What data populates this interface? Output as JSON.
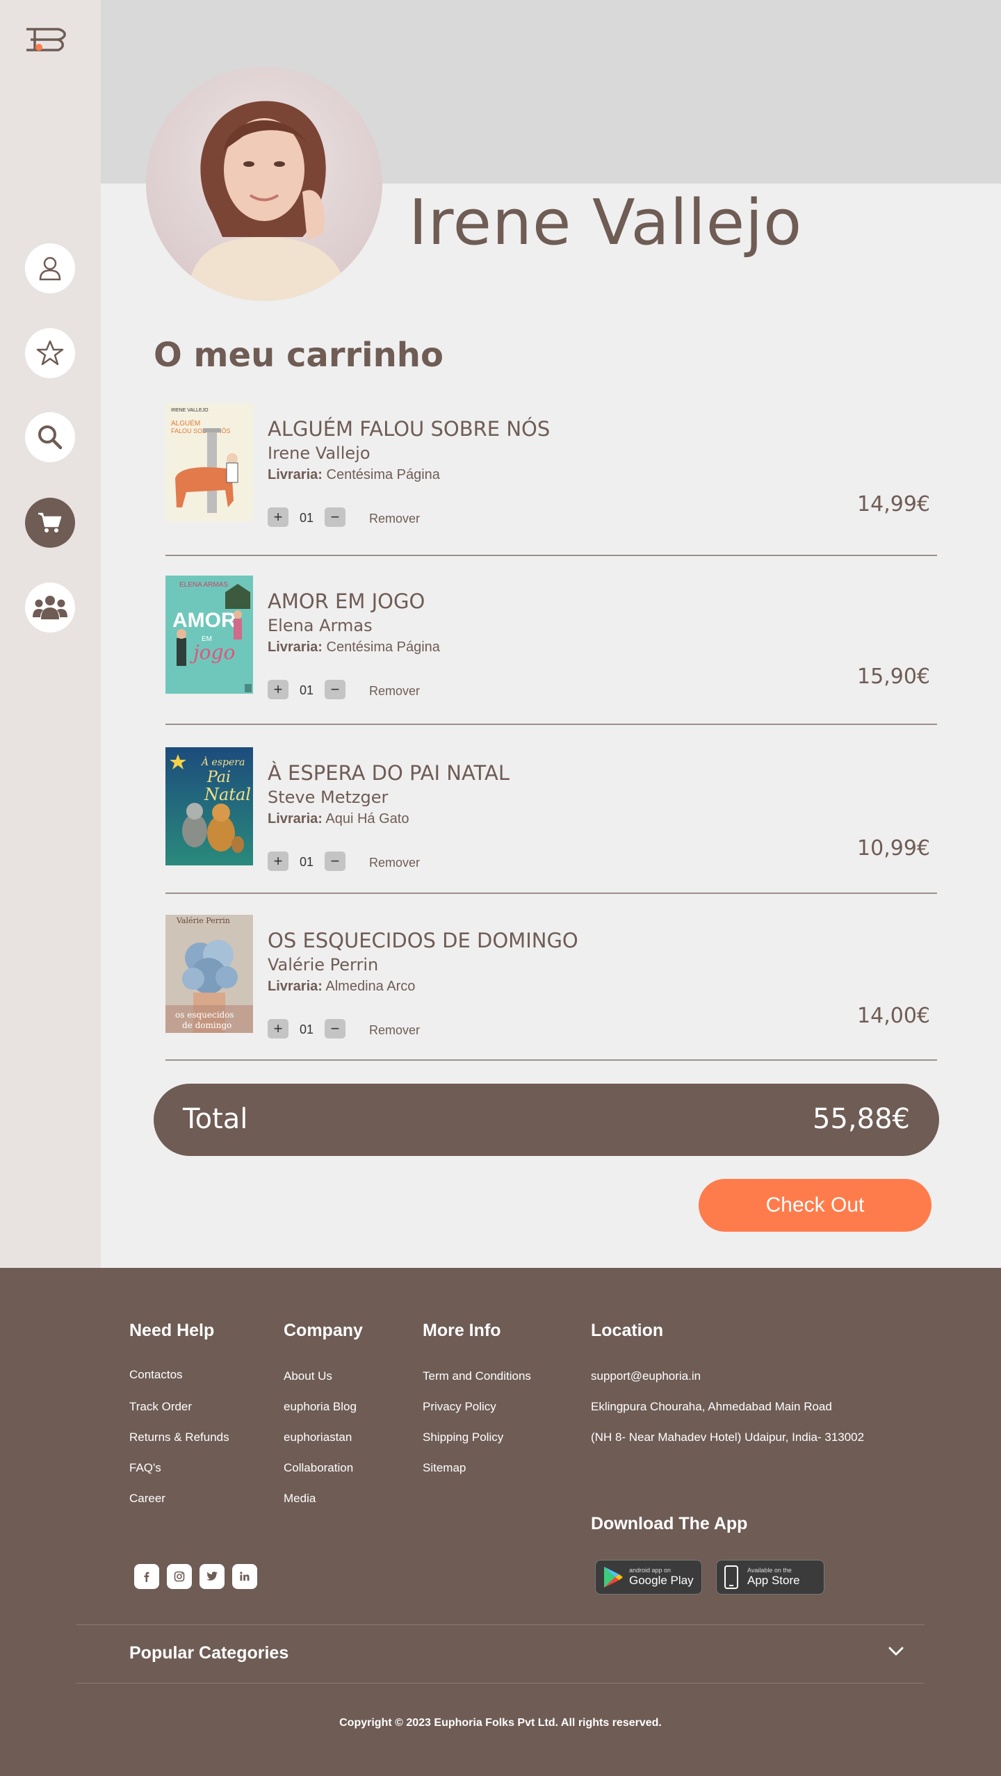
{
  "profile": {
    "name": "Irene Vallejo"
  },
  "cart": {
    "title": "O meu carrinho",
    "store_prefix": "Livraria:",
    "remove_label": "Remover",
    "items": [
      {
        "title": "ALGUÉM FALOU SOBRE NÓS",
        "author": "Irene Vallejo",
        "store": "Centésima Página",
        "qty": "01",
        "price": "14,99€",
        "cover_title": "ALGUÉM FALOU SOBRE NÓS",
        "cover_author": "IRENE VALLEJO"
      },
      {
        "title": "AMOR EM JOGO",
        "author": "Elena Armas",
        "store": "Centésima Página",
        "qty": "01",
        "price": "15,90€",
        "cover_title": "AMOR",
        "cover_sub": "EM",
        "cover_script": "jogo",
        "cover_author": "ELENA ARMAS"
      },
      {
        "title": "À ESPERA DO PAI NATAL",
        "author": "Steve Metzger",
        "store": "Aqui Há Gato",
        "qty": "01",
        "price": "10,99€",
        "cover_title": "À espera de Pai Natal"
      },
      {
        "title": "OS ESQUECIDOS DE DOMINGO",
        "author": "Valérie Perrin",
        "store": "Almedina Arco",
        "qty": "01",
        "price": "14,00€",
        "cover_title": "os esquecidos de domingo",
        "cover_author": "Valérie Perrin"
      }
    ],
    "total_label": "Total",
    "total_value": "55,88€",
    "checkout_label": "Check Out"
  },
  "footer": {
    "need_help": {
      "title": "Need Help",
      "links": [
        "Contactos",
        "Track Order",
        "Returns & Refunds",
        "FAQ's",
        "Career"
      ]
    },
    "company": {
      "title": "Company",
      "links": [
        "About Us",
        "euphoria Blog",
        "euphoriastan",
        "Collaboration",
        "Media"
      ]
    },
    "more_info": {
      "title": "More Info",
      "links": [
        "Term and Conditions",
        "Privacy Policy",
        "Shipping Policy",
        "Sitemap"
      ]
    },
    "location": {
      "title": "Location",
      "lines": [
        "support@euphoria.in",
        "Eklingpura Chouraha, Ahmedabad Main Road",
        "(NH 8- Near Mahadev Hotel) Udaipur, India- 313002"
      ]
    },
    "download": {
      "title": "Download The App",
      "google_small": "android app on",
      "google_big": "Google Play",
      "apple_small": "Available on the",
      "apple_big": "App Store"
    },
    "social": [
      "facebook-icon",
      "instagram-icon",
      "twitter-icon",
      "linkedin-icon"
    ],
    "popular_categories": "Popular Categories",
    "copyright": "Copyright © 2023 Euphoria Folks Pvt Ltd. All rights reserved."
  },
  "colors": {
    "brand": "#6e5c55",
    "accent": "#fe7c4b",
    "page_bg": "#f0efef",
    "sidebar_bg": "#e8e3e1",
    "banner_bg": "#d9d9d9"
  }
}
